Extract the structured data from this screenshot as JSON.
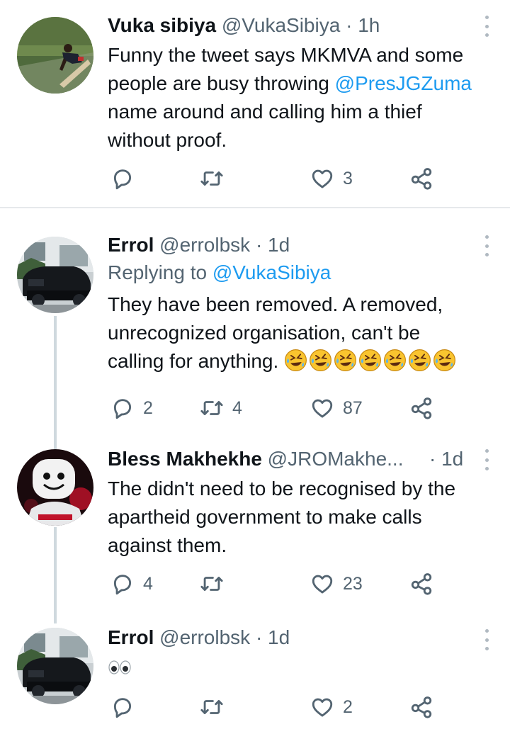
{
  "tweets": [
    {
      "name": "Vuka sibiya",
      "handle": "@VukaSibiya",
      "dot": "·",
      "time": "1h",
      "text_before": "Funny the tweet says MKMVA and some people are busy throwing ",
      "mention": "@PresJGZuma",
      "text_after": " name around and calling him a thief without proof.",
      "replies": "",
      "retweets": "",
      "likes": "3"
    },
    {
      "name": "Errol",
      "handle": "@errolbsk",
      "dot": "·",
      "time": "1d",
      "replying_label": "Replying to",
      "replying_to": "@VukaSibiya",
      "text": "They have been removed. A removed, unrecognized organisation, can't be calling for anything.",
      "emoji_name": "rolling-on-floor-laughing",
      "emoji_count": 7,
      "replies": "2",
      "retweets": "4",
      "likes": "87"
    },
    {
      "name": "Bless Makhekhe",
      "handle": "@JROMakhe...",
      "dot": "·",
      "time": "1d",
      "text": "The didn't need to be recognised by the apartheid government to make calls against them.",
      "replies": "4",
      "retweets": "",
      "likes": "23"
    },
    {
      "name": "Errol",
      "handle": "@errolbsk",
      "dot": "·",
      "time": "1d",
      "emoji_name": "eyes",
      "replies": "",
      "retweets": "",
      "likes": "2"
    }
  ],
  "icons": {
    "reply": "reply-icon",
    "retweet": "retweet-icon",
    "like": "heart-icon",
    "share": "share-icon",
    "more": "more-options-icon"
  },
  "colors": {
    "link": "#1d9bf0",
    "secondary_text": "#536471",
    "primary_text": "#0f1419",
    "thread_line": "#cfd9de",
    "divider": "#e6e9eb"
  }
}
